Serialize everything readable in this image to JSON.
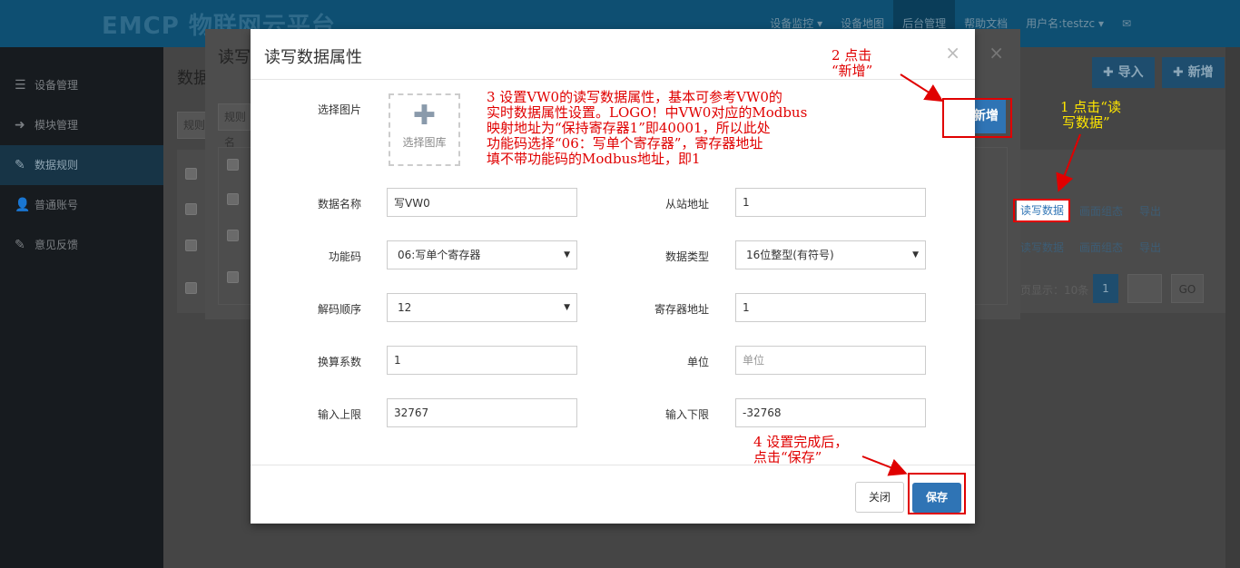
{
  "topbar": {
    "logo": "EMCP 物联网云平台",
    "nav": [
      "设备监控 ▾",
      "设备地图",
      "后台管理",
      "帮助文档",
      "用户名:testzc ▾"
    ]
  },
  "sidebar": {
    "items": [
      {
        "icon": "☰",
        "label": "设备管理"
      },
      {
        "icon": "➜",
        "label": "模块管理"
      },
      {
        "icon": "✎",
        "label": "数据规则"
      },
      {
        "icon": "👤",
        "label": "普通账号"
      },
      {
        "icon": "✎",
        "label": "意见反馈"
      }
    ]
  },
  "background": {
    "page_title": "数据",
    "import_label": "✚ 导入",
    "add_label": "✚ 新增",
    "search_placeholder": "规则",
    "rows": [
      {
        "read_write": "读写数据",
        "compose": "画面组态",
        "export": "导出"
      },
      {
        "read_write": "读写数据",
        "compose": "画面组态",
        "export": "导出"
      }
    ],
    "pager": {
      "page_size_text": "页显示：10条",
      "current_page": "1",
      "go_label": "GO"
    }
  },
  "back_modal": {
    "title": "读写",
    "filter_placeholder": "规则名"
  },
  "modal": {
    "title": "读写数据属性",
    "add_button_label": "新增",
    "row_read_write_label": "读写数据",
    "image_label": "选择图片",
    "image_button": "选择图库",
    "fields": {
      "data_name": {
        "label": "数据名称",
        "value": "写VW0"
      },
      "slave_address": {
        "label": "从站地址",
        "value": "1"
      },
      "function_code": {
        "label": "功能码",
        "value": "06:写单个寄存器"
      },
      "data_type": {
        "label": "数据类型",
        "value": "16位整型(有符号)"
      },
      "decode_order": {
        "label": "解码顺序",
        "value": "12"
      },
      "register_address": {
        "label": "寄存器地址",
        "value": "1"
      },
      "conversion_factor": {
        "label": "换算系数",
        "value": "1"
      },
      "unit": {
        "label": "单位",
        "placeholder": "单位",
        "value": ""
      },
      "upper_limit": {
        "label": "输入上限",
        "value": "32767"
      },
      "lower_limit": {
        "label": "输入下限",
        "value": "-32768"
      }
    },
    "close_label": "关闭",
    "save_label": "保存"
  },
  "annotations": {
    "step1": [
      "1 点击“读",
      "写数据”"
    ],
    "step2": [
      "2 点击",
      "“新增”"
    ],
    "step3": [
      "3 设置VW0的读写数据属性，基本可参考VW0的",
      "实时数据属性设置。LOGO！中VW0对应的Modbus",
      "映射地址为“保持寄存器1”即40001，所以此处",
      "功能码选择“06：写单个寄存器”，寄存器地址",
      "填不带功能码的Modbus地址，即1"
    ],
    "step4": [
      "4 设置完成后，",
      "点击“保存”"
    ]
  },
  "colors": {
    "annotation_red": "#e00000",
    "annotation_yellow": "#ffe600",
    "primary_blue": "#2f74b5"
  }
}
